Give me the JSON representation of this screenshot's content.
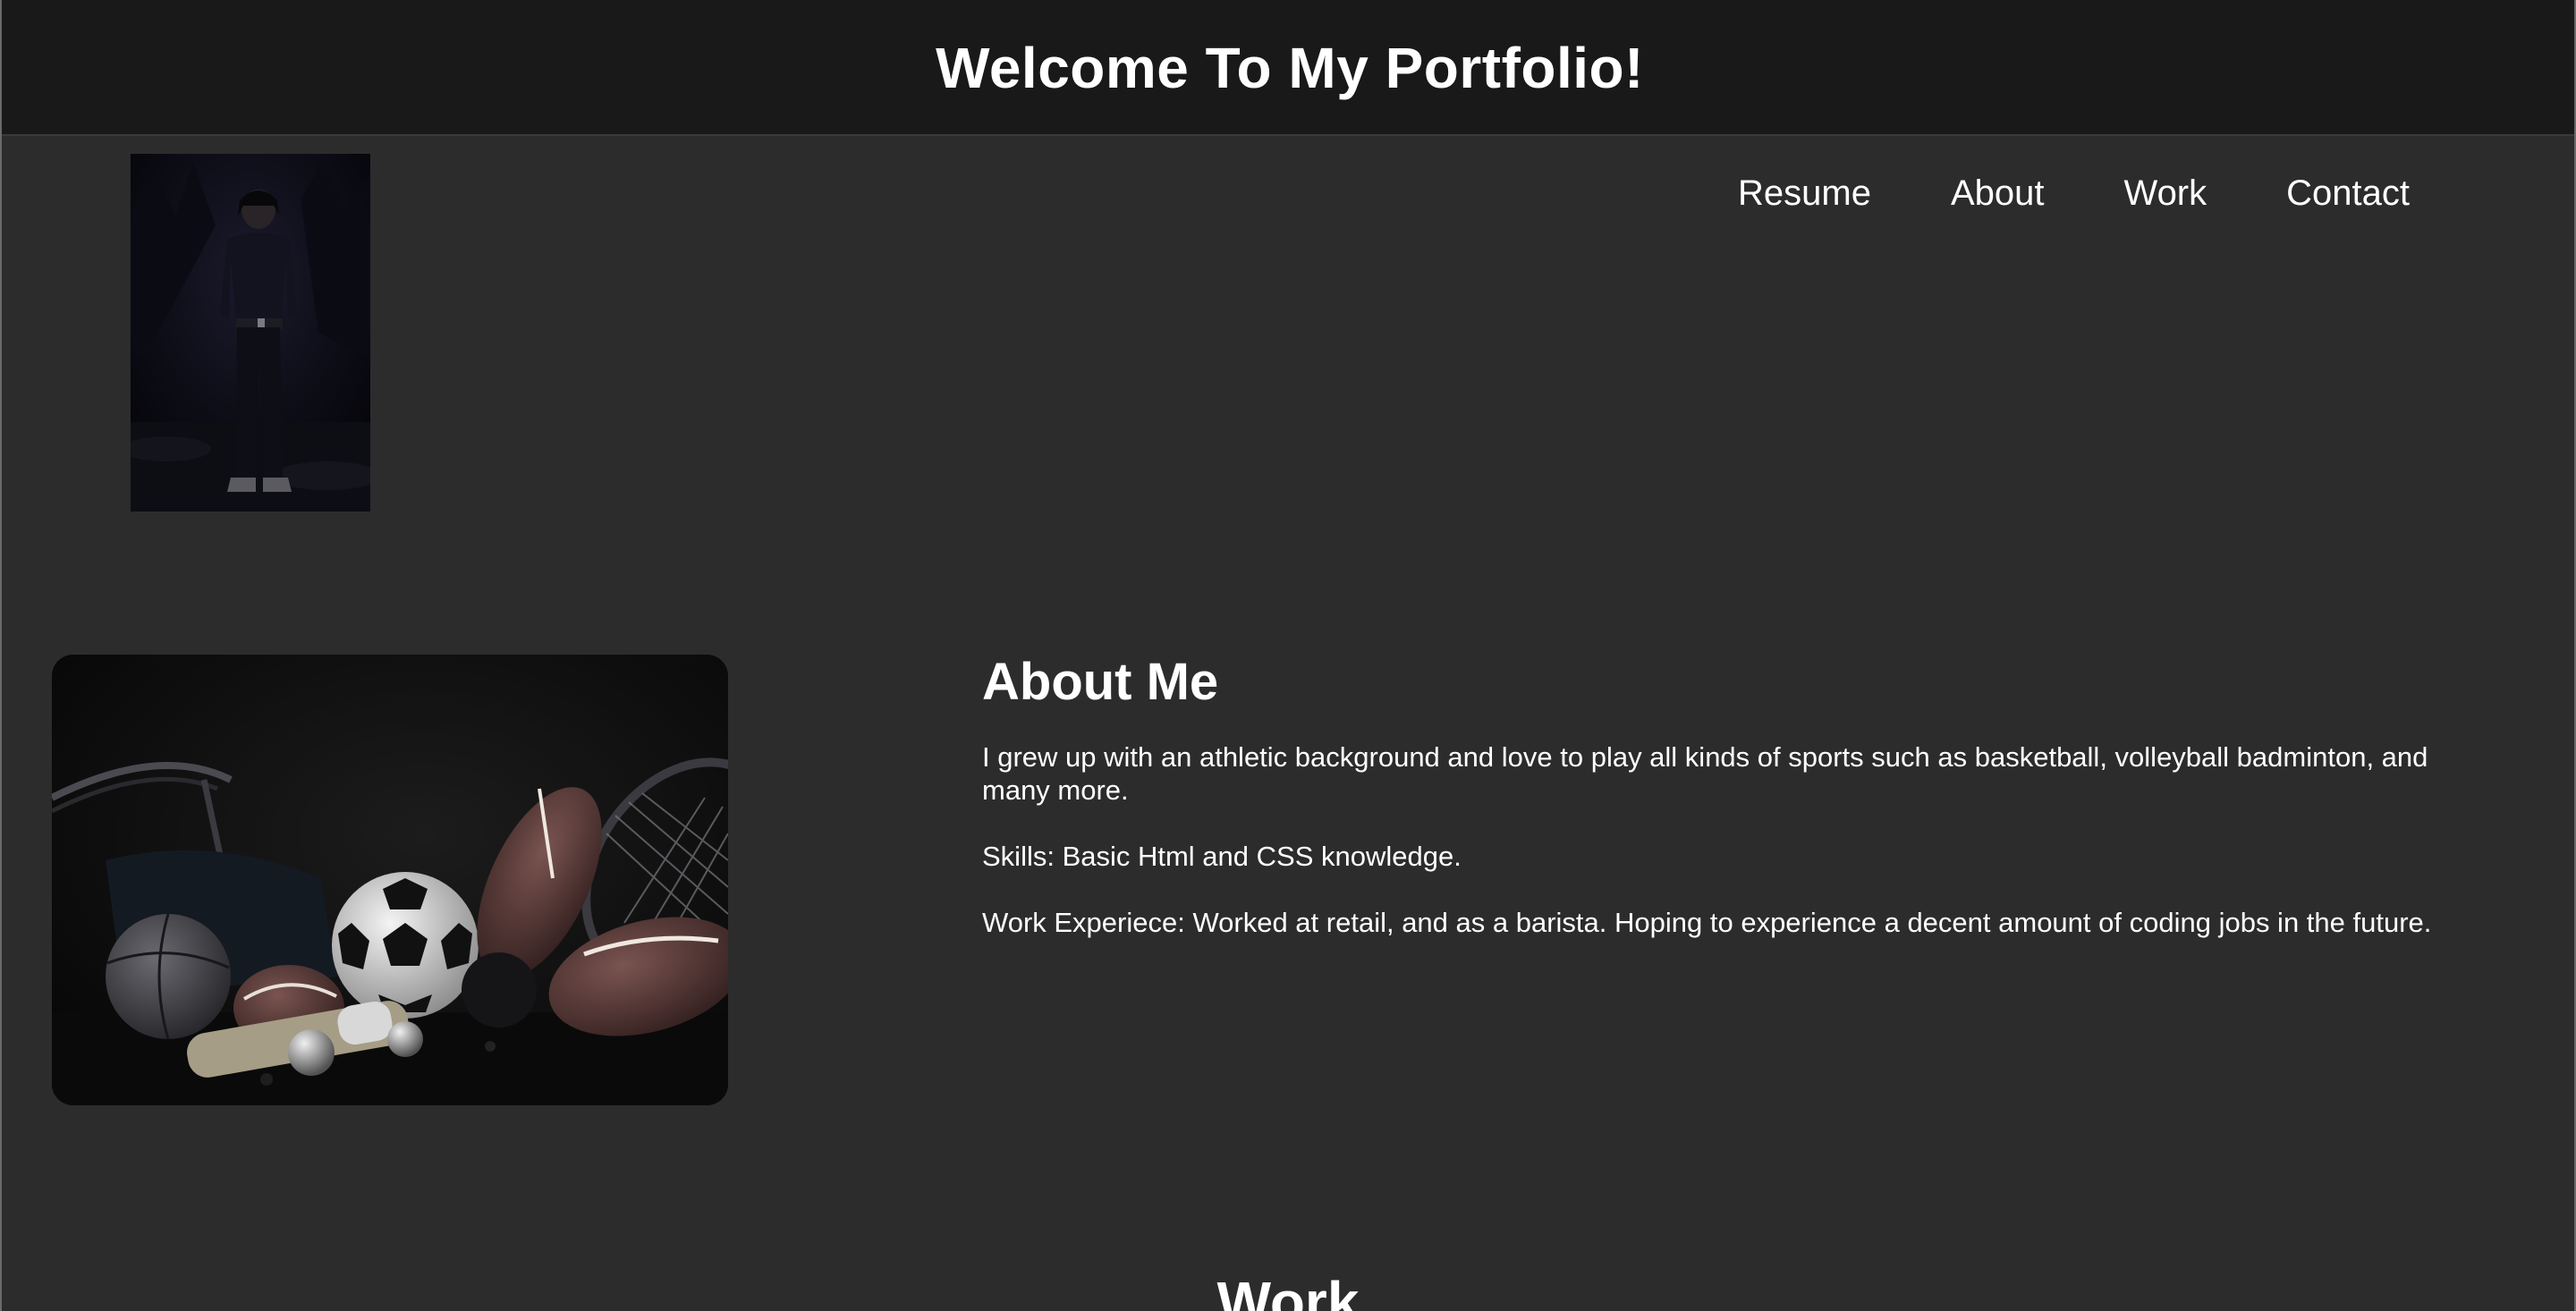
{
  "header": {
    "title": "Welcome To My Portfolio!"
  },
  "nav": {
    "items": [
      {
        "label": "Resume"
      },
      {
        "label": "About"
      },
      {
        "label": "Work"
      },
      {
        "label": "Contact"
      }
    ]
  },
  "images": {
    "profile": "profile-photo",
    "sports": "sports-equipment-image"
  },
  "about": {
    "heading": "About Me",
    "bio": "I grew up with an athletic background and love to play all kinds of sports such as basketball, volleyball badminton, and many more.",
    "skills": "Skills: Basic Html and CSS knowledge.",
    "work": "Work Experiece: Worked at retail, and as a barista. Hoping to experience a decent amount of coding jobs in the future."
  },
  "work_section": {
    "heading": "Work"
  },
  "colors": {
    "header_bg": "#191919",
    "page_bg": "#2c2c2c",
    "text": "#ffffff"
  }
}
